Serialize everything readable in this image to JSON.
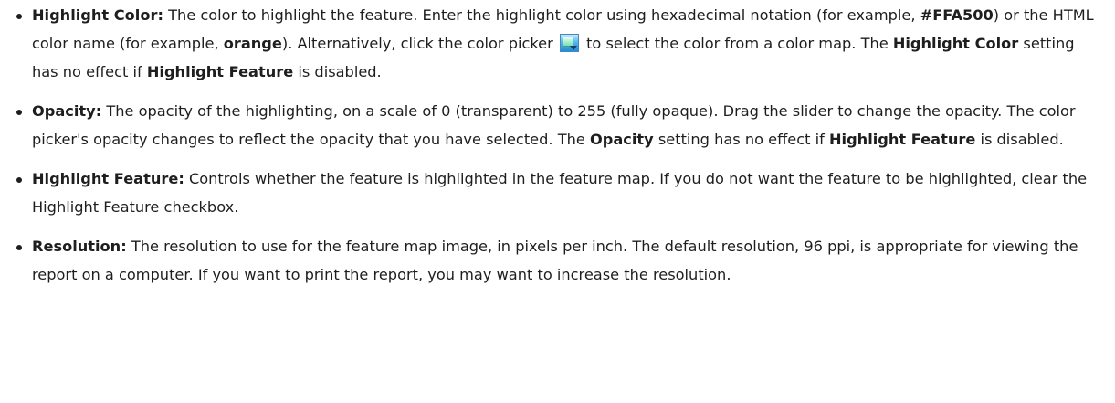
{
  "items": [
    {
      "term": "Highlight Color:",
      "t1": " The color to highlight the feature. Enter the highlight color using hexadecimal notation (for example, ",
      "b1": "#FFA500",
      "t2": ") or the HTML color name (for example, ",
      "b2": "orange",
      "t3": "). Alternatively, click the color picker ",
      "t4": " to select the color from a color map. The ",
      "b3": "Highlight Color",
      "t5": " setting has no effect if ",
      "b4": "Highlight Feature",
      "t6": " is disabled.",
      "picker_icon": "color-picker-icon"
    },
    {
      "term": "Opacity:",
      "t1": " The opacity of the highlighting, on a scale of 0 (transparent) to 255 (fully opaque). Drag the slider to change the opacity. The color picker's opacity changes to reflect the opacity that you have selected. The ",
      "b1": "Opacity",
      "t2": " setting has no effect if ",
      "b2": "Highlight Feature",
      "t3": " is disabled."
    },
    {
      "term": "Highlight Feature:",
      "t1": " Controls whether the feature is highlighted in the feature map. If you do not want the feature to be highlighted, clear the Highlight Feature checkbox."
    },
    {
      "term": "Resolution:",
      "t1": " The resolution to use for the feature map image, in pixels per inch. The default resolution, 96 ppi, is appropriate for viewing the report on a computer. If you want to print the report, you may want to increase the resolution."
    }
  ],
  "colors": {
    "text": "#1e1e1e",
    "background": "#ffffff"
  }
}
